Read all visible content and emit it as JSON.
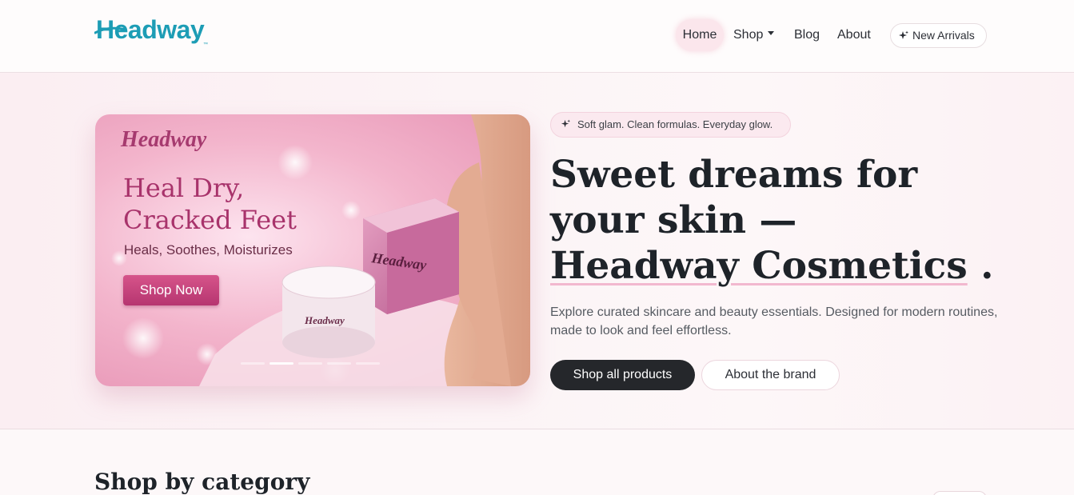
{
  "brand": {
    "name": "Headway"
  },
  "nav": {
    "items": [
      {
        "label": "Home"
      },
      {
        "label": "Shop"
      },
      {
        "label": "Blog"
      },
      {
        "label": "About"
      }
    ],
    "new_arrivals": "New Arrivals"
  },
  "banner": {
    "logo": "Headway",
    "title": "Heal Dry, Cracked Feet",
    "subtitle": "Heals, Soothes, Moisturizes",
    "cta": "Shop Now",
    "slides": 5,
    "active_slide": 2
  },
  "hero": {
    "tagline": "Soft glam. Clean formulas. Everyday glow.",
    "headline_pre": "Sweet dreams for your skin — ",
    "headline_brand": "Headway Cosmetics",
    "headline_post": " .",
    "description": "Explore curated skincare and beauty essentials. Designed for modern routines, made to look and feel effortless.",
    "primary_cta": "Shop all products",
    "secondary_cta": "About the brand"
  },
  "section": {
    "title": "Shop by category"
  },
  "colors": {
    "logo_teal": "#1d9db5",
    "accent_pink": "#b63570",
    "dark_button": "#25272b"
  }
}
